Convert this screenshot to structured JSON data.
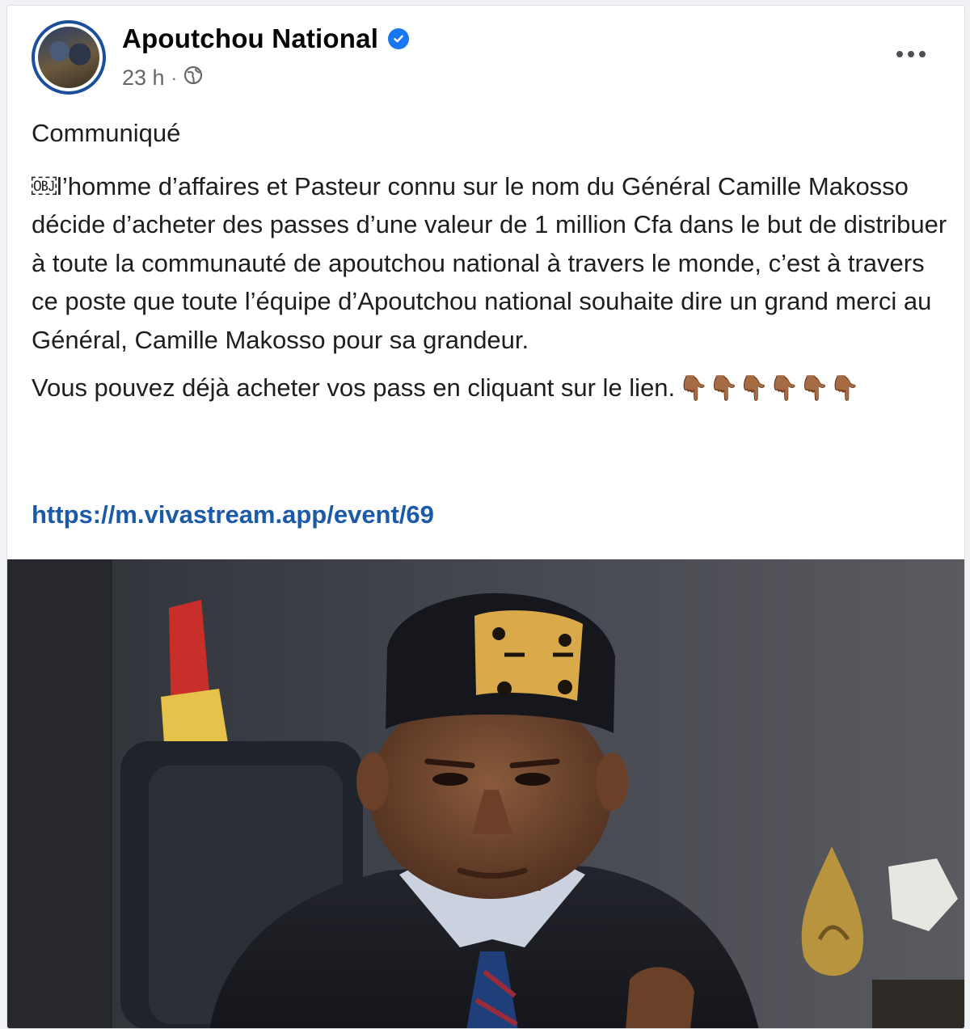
{
  "post": {
    "page_name": "Apoutchou National",
    "verified_icon": "verified-badge-icon",
    "time": "23 h",
    "separator": "·",
    "audience_icon": "globe-icon",
    "more_icon": "more-options-icon",
    "more_label": "···",
    "title": "Communiqué",
    "body_lead": "￼",
    "body": "l’homme d’affaires et Pasteur connu sur le nom du Général Camille Makosso décide d’acheter des passes d’une valeur de 1 million Cfa dans le but de distribuer à toute la communauté de apoutchou national à travers le monde, c’est à travers ce poste que toute l’équipe d’Apoutchou national souhaite dire un grand merci au Général, Camille Makosso pour sa grandeur.",
    "cta": "Vous pouvez déjà acheter vos pass en cliquant sur le lien.",
    "cta_emoji": "👇🏾👇🏾👇🏾👇🏾👇🏾👇🏾",
    "link": "https://m.vivastream.app/event/69"
  },
  "colors": {
    "verified": "#1877f2",
    "link": "#1b5aa8",
    "avatar_ring": "#1b4f9c",
    "meta_text": "#65676b"
  }
}
